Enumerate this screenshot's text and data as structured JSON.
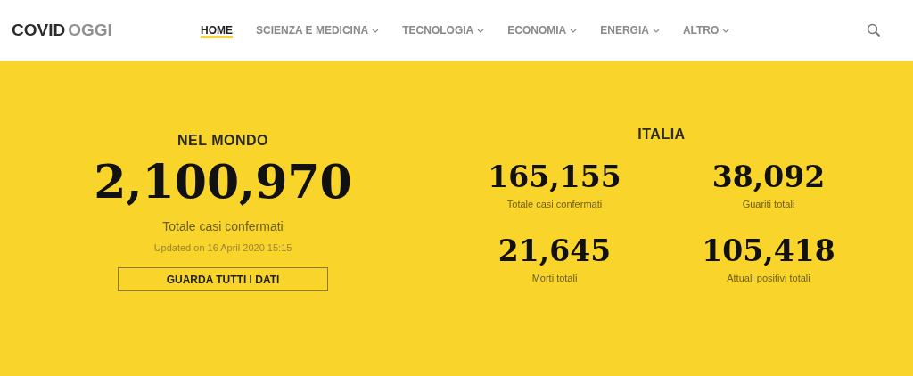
{
  "header": {
    "logo": {
      "primary": "COVID",
      "secondary": "OGGI"
    },
    "nav": [
      {
        "label": "HOME",
        "selected": true,
        "dropdown": false
      },
      {
        "label": "SCIENZA E MEDICINA",
        "selected": false,
        "dropdown": true
      },
      {
        "label": "TECNOLOGIA",
        "selected": false,
        "dropdown": true
      },
      {
        "label": "ECONOMIA",
        "selected": false,
        "dropdown": true
      },
      {
        "label": "ENERGIA",
        "selected": false,
        "dropdown": true
      },
      {
        "label": "ALTRO",
        "selected": false,
        "dropdown": true
      }
    ]
  },
  "world": {
    "heading": "NEL MONDO",
    "value": "2,100,970",
    "label": "Totale casi confermati",
    "updated": "Updated on 16 April 2020 15:15",
    "button": "GUARDA TUTTI I DATI"
  },
  "italy": {
    "heading": "ITALIA",
    "stats": [
      {
        "value": "165,155",
        "label": "Totale casi confermati"
      },
      {
        "value": "38,092",
        "label": "Guariti totali"
      },
      {
        "value": "21,645",
        "label": "Morti totali"
      },
      {
        "value": "105,418",
        "label": "Attuali positivi totali"
      }
    ]
  }
}
